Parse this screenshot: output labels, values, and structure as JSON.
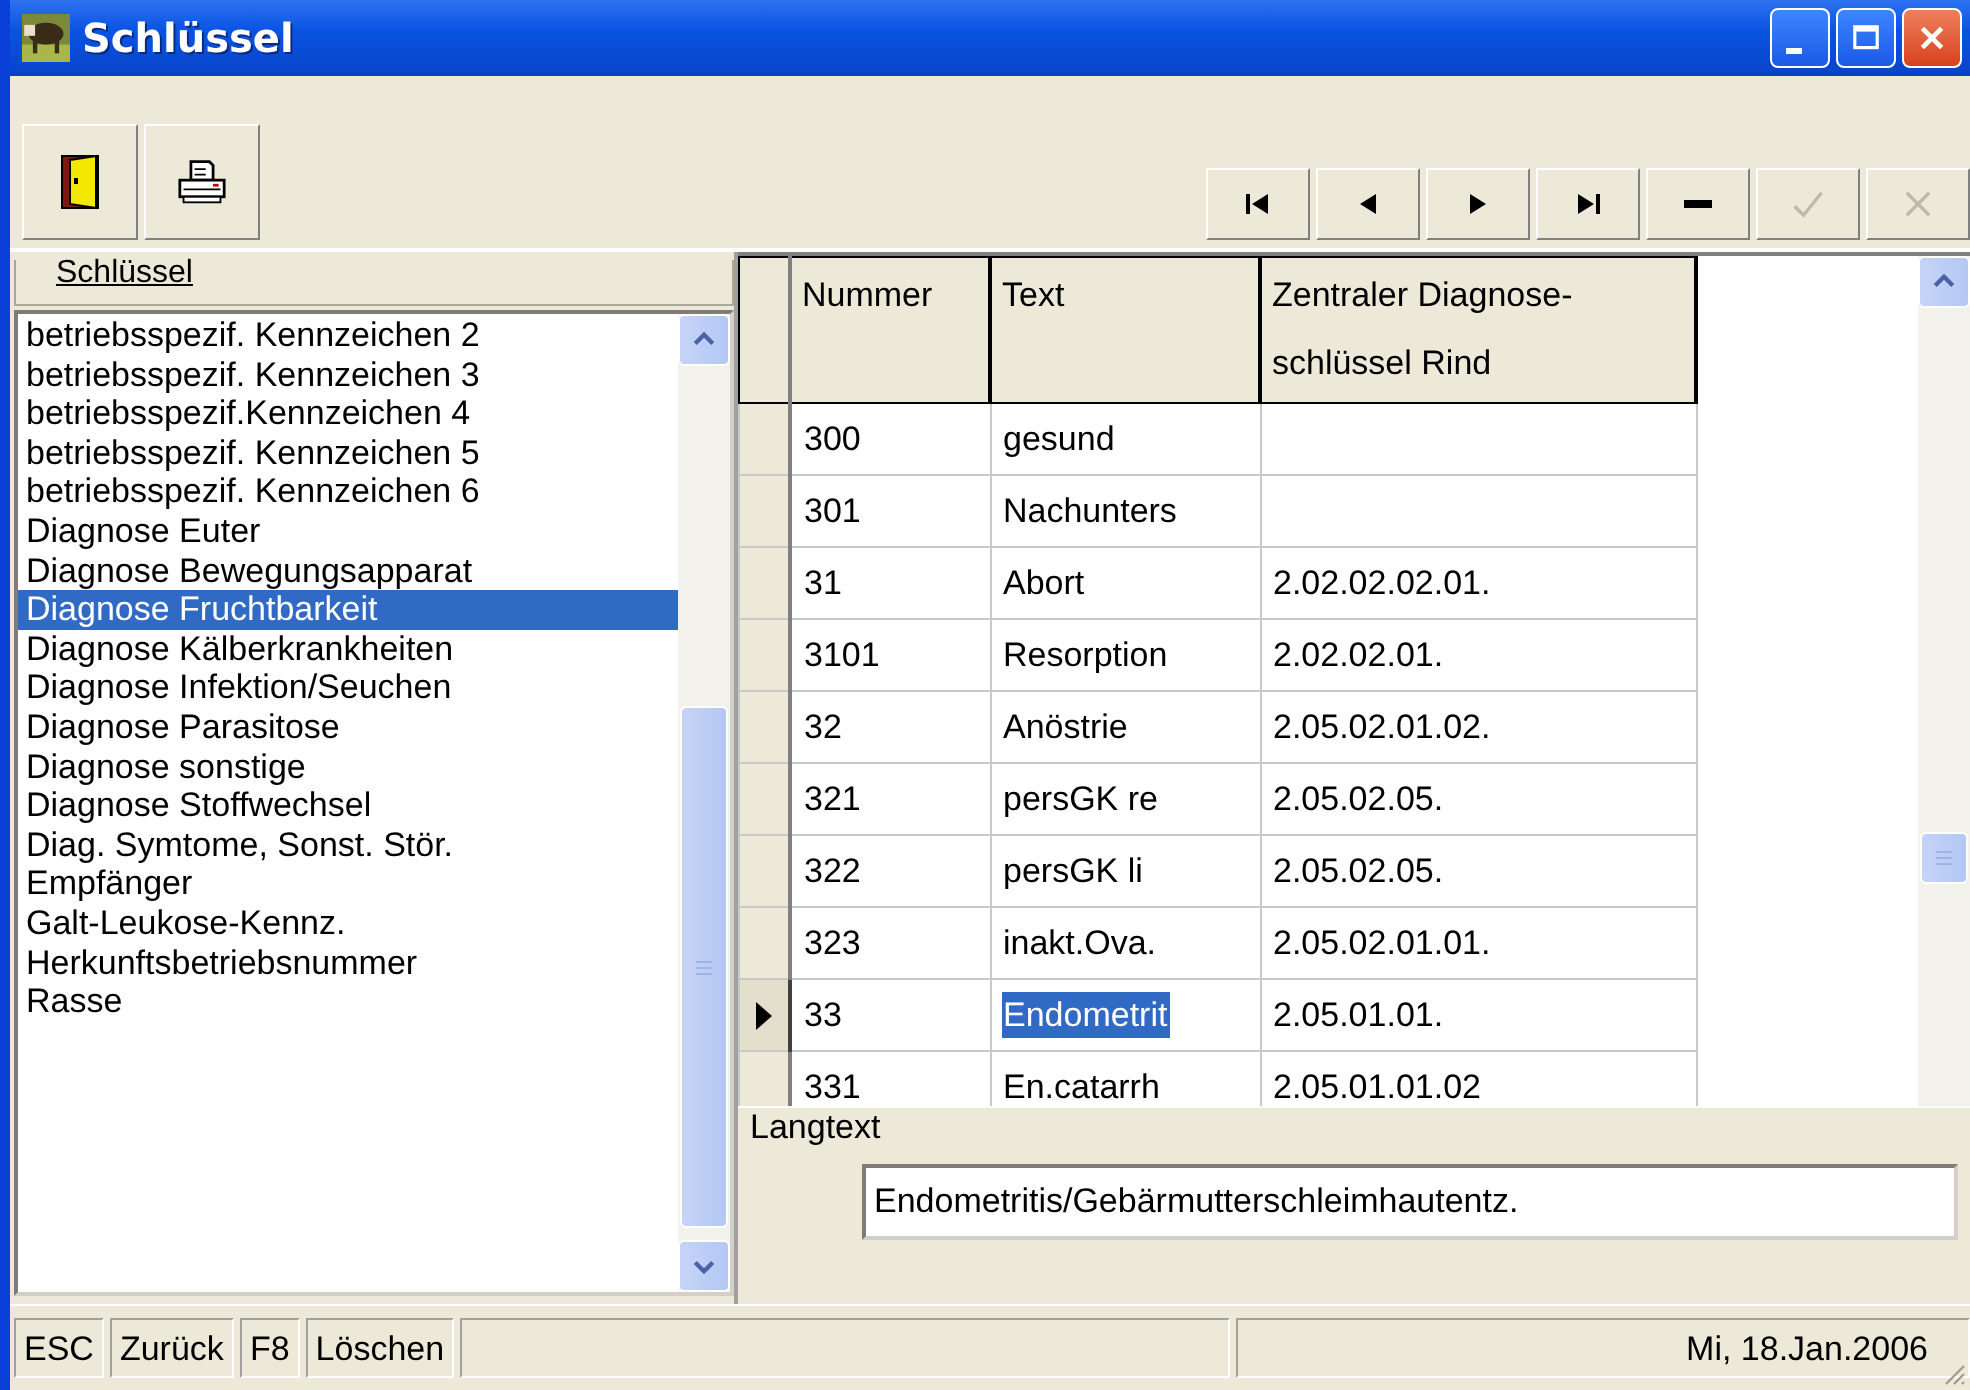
{
  "window": {
    "title": "Schlüssel"
  },
  "toolbar": {
    "left": [
      {
        "kind": "exit",
        "disabled": false
      },
      {
        "kind": "print",
        "disabled": false
      }
    ],
    "right": [
      {
        "kind": "first",
        "disabled": false
      },
      {
        "kind": "prev",
        "disabled": false
      },
      {
        "kind": "next",
        "disabled": false
      },
      {
        "kind": "last",
        "disabled": false
      },
      {
        "kind": "delete",
        "disabled": false
      },
      {
        "kind": "post",
        "disabled": true
      },
      {
        "kind": "cancel",
        "disabled": true
      }
    ]
  },
  "keys_panel": {
    "title": "Schlüssel",
    "items": [
      {
        "label": "betriebsspezif. Kennzeichen 2",
        "selected": false
      },
      {
        "label": "betriebsspezif. Kennzeichen 3",
        "selected": false
      },
      {
        "label": "betriebsspezif.Kennzeichen 4",
        "selected": false
      },
      {
        "label": "betriebsspezif. Kennzeichen 5",
        "selected": false
      },
      {
        "label": "betriebsspezif. Kennzeichen 6",
        "selected": false
      },
      {
        "label": "Diagnose Euter",
        "selected": false
      },
      {
        "label": "Diagnose Bewegungsapparat",
        "selected": false
      },
      {
        "label": "Diagnose Fruchtbarkeit",
        "selected": true
      },
      {
        "label": "Diagnose Kälberkrankheiten",
        "selected": false
      },
      {
        "label": "Diagnose Infektion/Seuchen",
        "selected": false
      },
      {
        "label": "Diagnose Parasitose",
        "selected": false
      },
      {
        "label": "Diagnose sonstige",
        "selected": false
      },
      {
        "label": "Diagnose Stoffwechsel",
        "selected": false
      },
      {
        "label": "Diag. Symtome, Sonst. Stör.",
        "selected": false
      },
      {
        "label": "Empfänger",
        "selected": false
      },
      {
        "label": "Galt-Leukose-Kennz.",
        "selected": false
      },
      {
        "label": "Herkunftsbetriebsnummer",
        "selected": false
      },
      {
        "label": "Rasse",
        "selected": false
      }
    ]
  },
  "table": {
    "columns": [
      "Nummer",
      "Text",
      "Zentraler Diagnose-schlüssel Rind"
    ],
    "rows": [
      {
        "cells": [
          "300",
          "gesund",
          ""
        ],
        "selected": false
      },
      {
        "cells": [
          "301",
          "Nachunters",
          ""
        ],
        "selected": false
      },
      {
        "cells": [
          "31",
          "Abort",
          "2.02.02.02.01."
        ],
        "selected": false
      },
      {
        "cells": [
          "3101",
          "Resorption",
          "2.02.02.01."
        ],
        "selected": false
      },
      {
        "cells": [
          "32",
          "Anöstrie",
          "2.05.02.01.02."
        ],
        "selected": false
      },
      {
        "cells": [
          "321",
          "persGK re",
          "2.05.02.05."
        ],
        "selected": false
      },
      {
        "cells": [
          "322",
          "persGK li",
          "2.05.02.05."
        ],
        "selected": false
      },
      {
        "cells": [
          "323",
          "inakt.Ova.",
          "2.05.02.01.01."
        ],
        "selected": false
      },
      {
        "cells": [
          "33",
          "Endometrit",
          "2.05.01.01."
        ],
        "selected": true
      },
      {
        "cells": [
          "331",
          "En.catarrh",
          "2.05.01.01.02"
        ],
        "selected": false
      }
    ]
  },
  "langtext": {
    "title": "Langtext",
    "value": "Endometritis/Gebärmutterschleimhautentz."
  },
  "status_bar": {
    "keys": [
      {
        "key": "ESC",
        "action": "Zurück"
      },
      {
        "key": "F8",
        "action": "Löschen"
      }
    ],
    "date": "Mi, 18.Jan.2006"
  }
}
